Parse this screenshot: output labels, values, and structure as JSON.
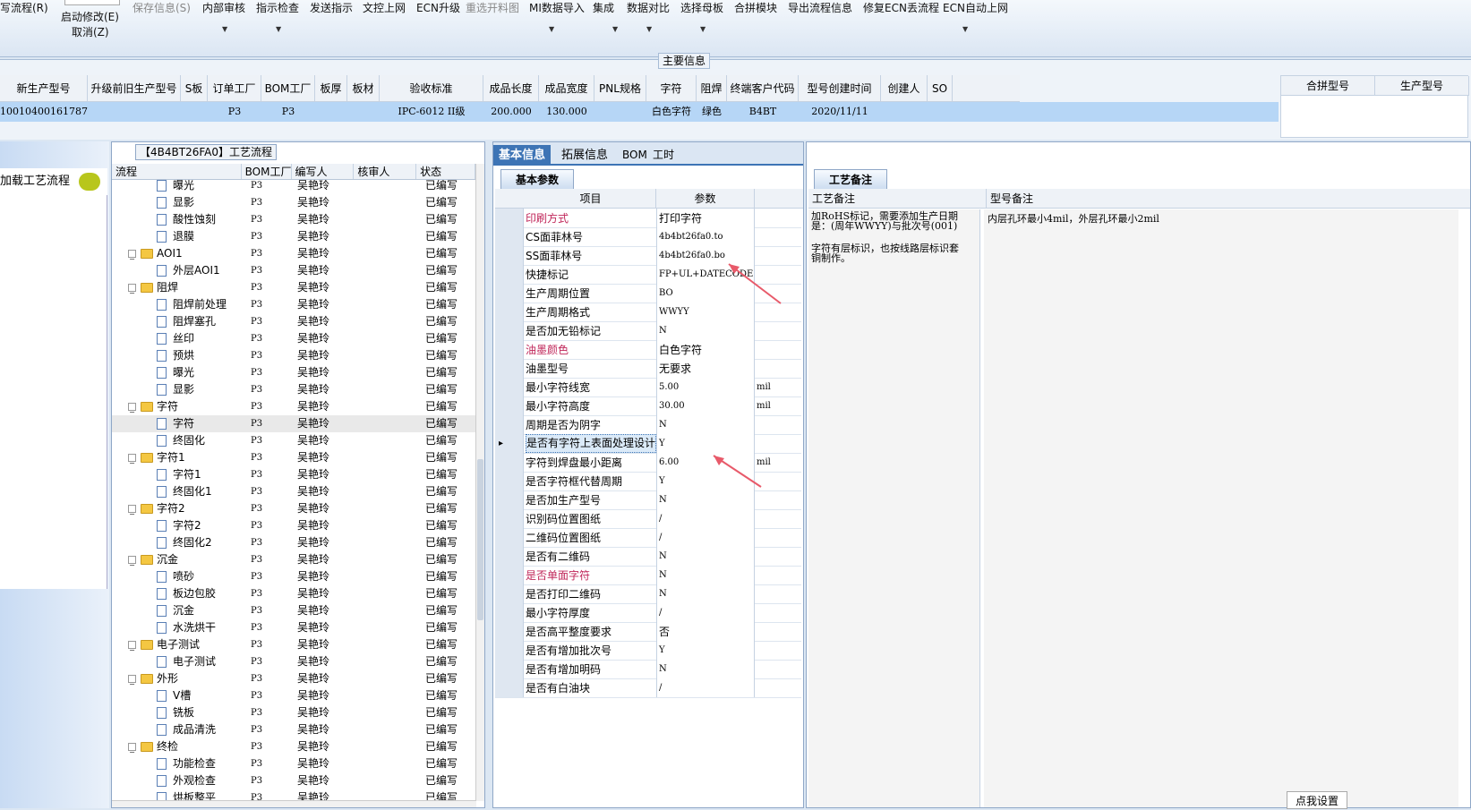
{
  "toolbar": {
    "items": [
      {
        "label": "写流程(R)"
      },
      {
        "label": "启动修改(E)",
        "sub": "取消(Z)"
      },
      {
        "label": "保存信息(S)"
      },
      {
        "label": "内部审核"
      },
      {
        "label": "指示检查"
      },
      {
        "label": "发送指示"
      },
      {
        "label": "文控上网"
      },
      {
        "label": "ECN升级"
      },
      {
        "label": "重选开料图"
      },
      {
        "label": "MI数据导入"
      },
      {
        "label": "集成"
      },
      {
        "label": "数据对比"
      },
      {
        "label": "选择母板"
      },
      {
        "label": "合拼模块"
      },
      {
        "label": "导出流程信息"
      },
      {
        "label": "修复ECN丢流程"
      },
      {
        "label": "ECN自动上网"
      }
    ]
  },
  "main_info": {
    "title": "主要信息",
    "columns": [
      "新生产型号",
      "升级前旧生产型号",
      "S板",
      "订单工厂",
      "BOM工厂",
      "板厚",
      "板材",
      "验收标准",
      "成品长度",
      "成品宽度",
      "PNL规格",
      "字符",
      "阻焊",
      "终端客户代码",
      "型号创建时间",
      "创建人",
      "SO"
    ],
    "row": [
      "10010400161787",
      "",
      "",
      "P3",
      "P3",
      "",
      "",
      "IPC-6012 II级",
      "200.000",
      "130.000",
      "",
      "白色字符",
      "绿色",
      "B4BT",
      "2020/11/11",
      "",
      ""
    ],
    "right_columns": [
      "合拼型号",
      "生产型号"
    ]
  },
  "left_panel": {
    "label": "加载工艺流程"
  },
  "flow": {
    "title": "【4B4BT26FA0】工艺流程",
    "columns": [
      "流程",
      "BOM工厂",
      "编写人",
      "核审人",
      "状态"
    ],
    "rows": [
      {
        "name": "曝光",
        "level": 2,
        "folder": false,
        "bom": "P3",
        "author": "吴艳玲",
        "status": "已编写"
      },
      {
        "name": "显影",
        "level": 2,
        "folder": false,
        "bom": "P3",
        "author": "吴艳玲",
        "status": "已编写"
      },
      {
        "name": "酸性蚀刻",
        "level": 2,
        "folder": false,
        "bom": "P3",
        "author": "吴艳玲",
        "status": "已编写"
      },
      {
        "name": "退膜",
        "level": 2,
        "folder": false,
        "bom": "P3",
        "author": "吴艳玲",
        "status": "已编写"
      },
      {
        "name": "AOI1",
        "level": 1,
        "folder": true,
        "bom": "P3",
        "author": "吴艳玲",
        "status": "已编写"
      },
      {
        "name": "外层AOI1",
        "level": 2,
        "folder": false,
        "bom": "P3",
        "author": "吴艳玲",
        "status": "已编写"
      },
      {
        "name": "阻焊",
        "level": 1,
        "folder": true,
        "bom": "P3",
        "author": "吴艳玲",
        "status": "已编写"
      },
      {
        "name": "阻焊前处理",
        "level": 2,
        "folder": false,
        "bom": "P3",
        "author": "吴艳玲",
        "status": "已编写"
      },
      {
        "name": "阻焊塞孔",
        "level": 2,
        "folder": false,
        "bom": "P3",
        "author": "吴艳玲",
        "status": "已编写"
      },
      {
        "name": "丝印",
        "level": 2,
        "folder": false,
        "bom": "P3",
        "author": "吴艳玲",
        "status": "已编写"
      },
      {
        "name": "预烘",
        "level": 2,
        "folder": false,
        "bom": "P3",
        "author": "吴艳玲",
        "status": "已编写"
      },
      {
        "name": "曝光",
        "level": 2,
        "folder": false,
        "bom": "P3",
        "author": "吴艳玲",
        "status": "已编写"
      },
      {
        "name": "显影",
        "level": 2,
        "folder": false,
        "bom": "P3",
        "author": "吴艳玲",
        "status": "已编写"
      },
      {
        "name": "字符",
        "level": 1,
        "folder": true,
        "bom": "P3",
        "author": "吴艳玲",
        "status": "已编写"
      },
      {
        "name": "字符",
        "level": 2,
        "folder": false,
        "bom": "P3",
        "author": "吴艳玲",
        "status": "已编写",
        "selected": true
      },
      {
        "name": "终固化",
        "level": 2,
        "folder": false,
        "bom": "P3",
        "author": "吴艳玲",
        "status": "已编写"
      },
      {
        "name": "字符1",
        "level": 1,
        "folder": true,
        "bom": "P3",
        "author": "吴艳玲",
        "status": "已编写"
      },
      {
        "name": "字符1",
        "level": 2,
        "folder": false,
        "bom": "P3",
        "author": "吴艳玲",
        "status": "已编写"
      },
      {
        "name": "终固化1",
        "level": 2,
        "folder": false,
        "bom": "P3",
        "author": "吴艳玲",
        "status": "已编写"
      },
      {
        "name": "字符2",
        "level": 1,
        "folder": true,
        "bom": "P3",
        "author": "吴艳玲",
        "status": "已编写"
      },
      {
        "name": "字符2",
        "level": 2,
        "folder": false,
        "bom": "P3",
        "author": "吴艳玲",
        "status": "已编写"
      },
      {
        "name": "终固化2",
        "level": 2,
        "folder": false,
        "bom": "P3",
        "author": "吴艳玲",
        "status": "已编写"
      },
      {
        "name": "沉金",
        "level": 1,
        "folder": true,
        "bom": "P3",
        "author": "吴艳玲",
        "status": "已编写"
      },
      {
        "name": "喷砂",
        "level": 2,
        "folder": false,
        "bom": "P3",
        "author": "吴艳玲",
        "status": "已编写"
      },
      {
        "name": "板边包胶",
        "level": 2,
        "folder": false,
        "bom": "P3",
        "author": "吴艳玲",
        "status": "已编写"
      },
      {
        "name": "沉金",
        "level": 2,
        "folder": false,
        "bom": "P3",
        "author": "吴艳玲",
        "status": "已编写"
      },
      {
        "name": "水洗烘干",
        "level": 2,
        "folder": false,
        "bom": "P3",
        "author": "吴艳玲",
        "status": "已编写"
      },
      {
        "name": "电子测试",
        "level": 1,
        "folder": true,
        "bom": "P3",
        "author": "吴艳玲",
        "status": "已编写"
      },
      {
        "name": "电子测试",
        "level": 2,
        "folder": false,
        "bom": "P3",
        "author": "吴艳玲",
        "status": "已编写"
      },
      {
        "name": "外形",
        "level": 1,
        "folder": true,
        "bom": "P3",
        "author": "吴艳玲",
        "status": "已编写"
      },
      {
        "name": "V槽",
        "level": 2,
        "folder": false,
        "bom": "P3",
        "author": "吴艳玲",
        "status": "已编写"
      },
      {
        "name": "铣板",
        "level": 2,
        "folder": false,
        "bom": "P3",
        "author": "吴艳玲",
        "status": "已编写"
      },
      {
        "name": "成品清洗",
        "level": 2,
        "folder": false,
        "bom": "P3",
        "author": "吴艳玲",
        "status": "已编写"
      },
      {
        "name": "终检",
        "level": 1,
        "folder": true,
        "bom": "P3",
        "author": "吴艳玲",
        "status": "已编写"
      },
      {
        "name": "功能检查",
        "level": 2,
        "folder": false,
        "bom": "P3",
        "author": "吴艳玲",
        "status": "已编写"
      },
      {
        "name": "外观检查",
        "level": 2,
        "folder": false,
        "bom": "P3",
        "author": "吴艳玲",
        "status": "已编写"
      },
      {
        "name": "烘板整平",
        "level": 2,
        "folder": false,
        "bom": "P3",
        "author": "吴艳玲",
        "status": "已编写"
      }
    ]
  },
  "tabs": [
    "基本信息",
    "拓展信息",
    "BOM",
    "工时"
  ],
  "params": {
    "tab": "基本参数",
    "columns": [
      "项目",
      "参数"
    ],
    "rows": [
      {
        "item": "印刷方式",
        "value": "打印字符",
        "unit": "",
        "hl": true
      },
      {
        "item": "CS面菲林号",
        "value": "4b4bt26fa0.to",
        "unit": ""
      },
      {
        "item": "SS面菲林号",
        "value": "4b4bt26fa0.bo",
        "unit": ""
      },
      {
        "item": "快捷标记",
        "value": "FP+UL+DATECODE",
        "unit": ""
      },
      {
        "item": "生产周期位置",
        "value": "BO",
        "unit": ""
      },
      {
        "item": "生产周期格式",
        "value": "WWYY",
        "unit": ""
      },
      {
        "item": "是否加无铅标记",
        "value": "N",
        "unit": ""
      },
      {
        "item": "油墨颜色",
        "value": "白色字符",
        "unit": "",
        "hl": true
      },
      {
        "item": "油墨型号",
        "value": "无要求",
        "unit": ""
      },
      {
        "item": "最小字符线宽",
        "value": "5.00",
        "unit": "mil"
      },
      {
        "item": "最小字符高度",
        "value": "30.00",
        "unit": "mil"
      },
      {
        "item": "周期是否为阴字",
        "value": "N",
        "unit": ""
      },
      {
        "item": "是否有字符上表面处理设计",
        "value": "Y",
        "unit": "",
        "selected": true
      },
      {
        "item": "字符到焊盘最小距离",
        "value": "6.00",
        "unit": "mil"
      },
      {
        "item": "是否字符框代替周期",
        "value": "Y",
        "unit": ""
      },
      {
        "item": "是否加生产型号",
        "value": "N",
        "unit": ""
      },
      {
        "item": "识别码位置图纸",
        "value": "/",
        "unit": ""
      },
      {
        "item": "二维码位置图纸",
        "value": "/",
        "unit": ""
      },
      {
        "item": "是否有二维码",
        "value": "N",
        "unit": ""
      },
      {
        "item": "是否单面字符",
        "value": "N",
        "unit": "",
        "hl": true
      },
      {
        "item": "是否打印二维码",
        "value": "N",
        "unit": ""
      },
      {
        "item": "最小字符厚度",
        "value": "/",
        "unit": ""
      },
      {
        "item": "是否高平整度要求",
        "value": "否",
        "unit": ""
      },
      {
        "item": "是否有增加批次号",
        "value": "Y",
        "unit": ""
      },
      {
        "item": "是否有增加明码",
        "value": "N",
        "unit": ""
      },
      {
        "item": "是否有白油块",
        "value": "/",
        "unit": ""
      }
    ]
  },
  "notes": {
    "tab": "工艺备注",
    "col1": "工艺备注",
    "col2": "型号备注",
    "note1": "加RoHS标记，需要添加生产日期是：(周年WWYY)与批次号(001)",
    "note1b": "字符有层标识，也按线路层标识套铜制作。",
    "note2": "内层孔环最小4mil，外层孔环最小2mil",
    "button": "点我设置"
  },
  "colors": {
    "accent": "#3d74b5",
    "highlight": "#b6d6f6",
    "annot": "#c0275a",
    "arrow": "#e85a6a"
  }
}
